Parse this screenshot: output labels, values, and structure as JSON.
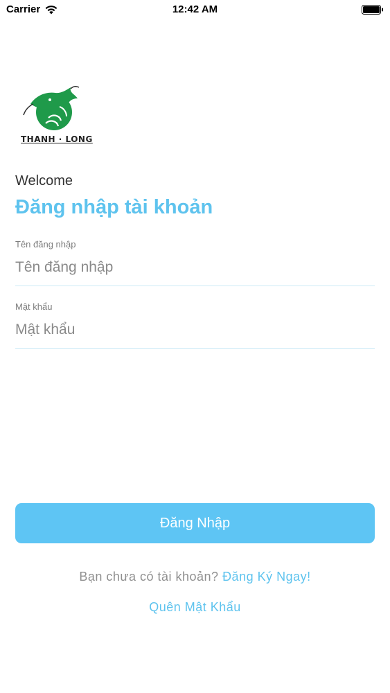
{
  "status_bar": {
    "carrier": "Carrier",
    "time": "12:42 AM",
    "wifi_icon": "wifi-icon",
    "battery_icon": "battery-icon"
  },
  "logo": {
    "text": "THANH · LONG",
    "icon": "dragon-logo-icon",
    "brand_color": "#1f9a4a"
  },
  "header": {
    "welcome": "Welcome",
    "title": "Đăng nhập tài khoản"
  },
  "form": {
    "username": {
      "label": "Tên đăng nhập",
      "placeholder": "Tên đăng nhập",
      "value": ""
    },
    "password": {
      "label": "Mật khẩu",
      "placeholder": "Mật khẩu",
      "value": ""
    },
    "login_label": "Đăng Nhập"
  },
  "footer": {
    "no_account_text": "Bạn chưa có tài khoản?",
    "register_label": "Đăng Ký Ngay!",
    "forgot_label": "Quên Mật Khẩu"
  },
  "colors": {
    "accent": "#5ec3ee",
    "button": "#5ec5f4",
    "underline": "#cdeaf6"
  }
}
